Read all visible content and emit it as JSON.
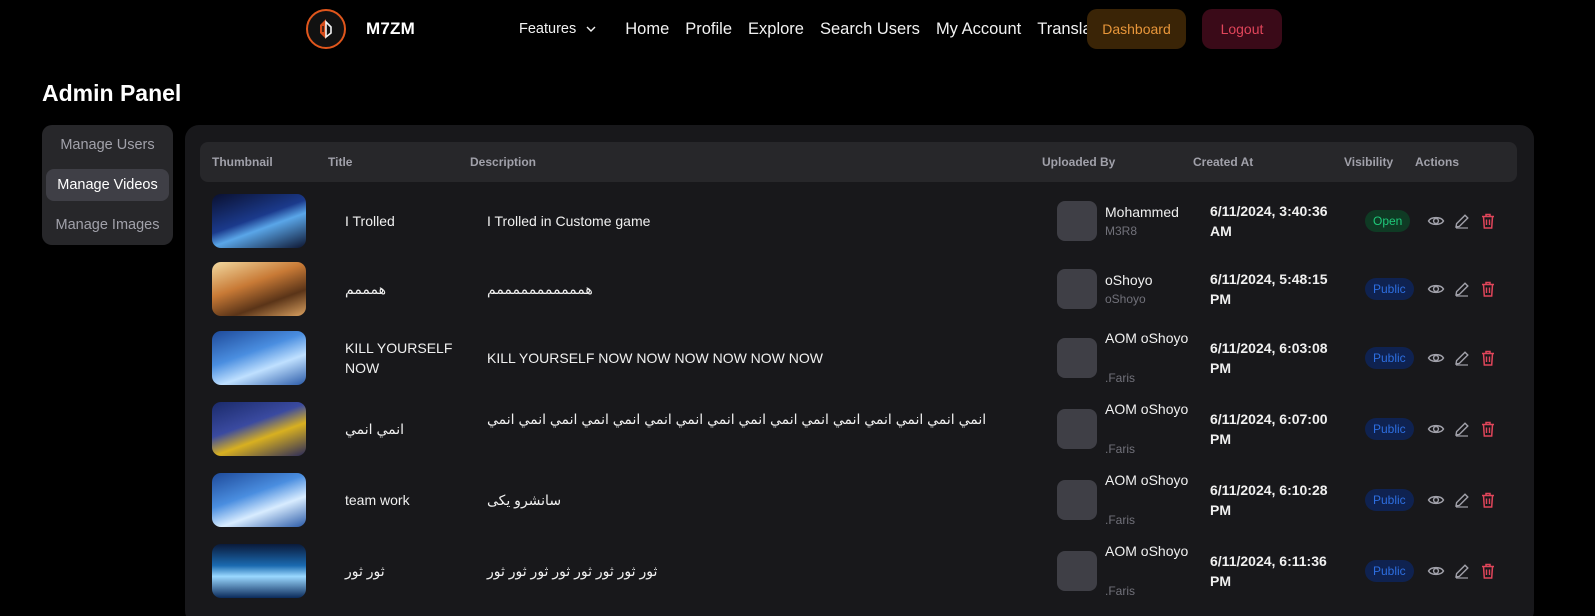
{
  "brand": {
    "name": "M7ZM"
  },
  "nav": {
    "features": "Features",
    "links": [
      "Home",
      "Profile",
      "Explore",
      "Search Users",
      "My Account",
      "Translate"
    ],
    "dashboard": "Dashboard",
    "logout": "Logout"
  },
  "page_title": "Admin Panel",
  "sidebar": {
    "items": [
      {
        "label": "Manage Users",
        "active": false
      },
      {
        "label": "Manage Videos",
        "active": true
      },
      {
        "label": "Manage Images",
        "active": false
      }
    ]
  },
  "table": {
    "headers": [
      "Thumbnail",
      "Title",
      "Description",
      "Uploaded By",
      "Created At",
      "Visibility",
      "Actions"
    ],
    "rows": [
      {
        "title": "I Trolled",
        "description": "I Trolled in Custome game",
        "uploader": "Mohammed",
        "handle": "M3R8",
        "created": "6/11/2024, 3:40:36 AM",
        "visibility": "Open"
      },
      {
        "title": "همممم",
        "description": "همممممممممممم",
        "uploader": "oShoyo",
        "handle": "oShoyo",
        "created": "6/11/2024, 5:48:15 PM",
        "visibility": "Public"
      },
      {
        "title": "KILL YOURSELF NOW",
        "description": "KILL YOURSELF NOW NOW NOW NOW NOW NOW",
        "uploader": "AOM oShoyo",
        "handle": ".Faris",
        "created": "6/11/2024, 6:03:08 PM",
        "visibility": "Public"
      },
      {
        "title": "انمي انمي",
        "description": "انمي انمي انمي انمي انمي انمي انمي انمي انمي انمي انمي انمي انمي انمي انمي انمي",
        "uploader": "AOM oShoyo",
        "handle": ".Faris",
        "created": "6/11/2024, 6:07:00 PM",
        "visibility": "Public"
      },
      {
        "title": "team work",
        "description": "سانشرو يكى",
        "uploader": "AOM oShoyo",
        "handle": ".Faris",
        "created": "6/11/2024, 6:10:28 PM",
        "visibility": "Public"
      },
      {
        "title": "ثور ثور",
        "description": "ثور ثور ثور ثور ثور ثور ثور ثور",
        "uploader": "AOM oShoyo",
        "handle": ".Faris",
        "created": "6/11/2024, 6:11:36 PM",
        "visibility": "Public"
      }
    ]
  },
  "icons": {
    "view": "eye-icon",
    "edit": "pencil-icon",
    "delete": "trash-icon"
  },
  "colors": {
    "dashboard_text": "#e8963a",
    "logout_text": "#e0455a",
    "open_badge": "#1fc97a",
    "public_badge": "#2d6ee0",
    "delete_icon": "#e0455a"
  }
}
